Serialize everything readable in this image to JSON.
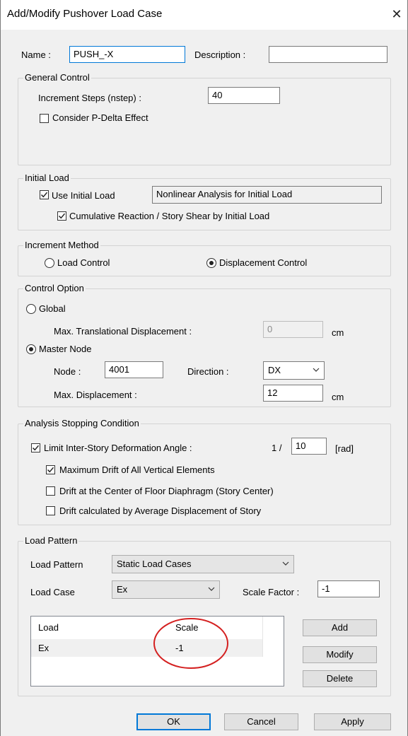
{
  "window": {
    "title": "Add/Modify Pushover Load Case"
  },
  "name_row": {
    "name_label": "Name :",
    "name_value": "PUSH_-X",
    "description_label": "Description :",
    "description_value": ""
  },
  "general_control": {
    "legend": "General Control",
    "increment_steps_label": "Increment Steps (nstep) :",
    "increment_steps_value": "40",
    "p_delta_label": "Consider P-Delta Effect",
    "p_delta_checked": false
  },
  "initial_load": {
    "legend": "Initial Load",
    "use_initial_load_label": "Use Initial Load",
    "use_initial_load_checked": true,
    "nonlinear_button_label": "Nonlinear Analysis for Initial Load",
    "cumulative_label": "Cumulative Reaction / Story Shear by Initial Load",
    "cumulative_checked": true
  },
  "increment_method": {
    "legend": "Increment Method",
    "load_control_label": "Load Control",
    "displacement_control_label": "Displacement Control",
    "selected": "displacement"
  },
  "control_option": {
    "legend": "Control Option",
    "global_label": "Global",
    "max_translational_label": "Max. Translational Displacement :",
    "max_translational_value": "0",
    "unit_cm": "cm",
    "master_node_label": "Master Node",
    "selected": "master",
    "node_label": "Node :",
    "node_value": "4001",
    "direction_label": "Direction :",
    "direction_value": "DX",
    "max_displacement_label": "Max. Displacement :",
    "max_displacement_value": "12",
    "unit_cm2": "cm"
  },
  "stopping": {
    "legend": "Analysis Stopping Condition",
    "limit_label": "Limit Inter-Story Deformation Angle  :",
    "limit_checked": true,
    "ratio_prefix": "1 /",
    "ratio_value": "10",
    "rad_unit": "[rad]",
    "options": [
      {
        "label": "Maximum Drift of All Vertical Elements",
        "checked": true
      },
      {
        "label": "Drift at the Center of Floor Diaphragm (Story Center)",
        "checked": false
      },
      {
        "label": "Drift calculated by Average Displacement of Story",
        "checked": false
      }
    ]
  },
  "load_pattern": {
    "legend": "Load Pattern",
    "pattern_label": "Load Pattern",
    "pattern_value": "Static Load Cases",
    "case_label": "Load Case",
    "case_value": "Ex",
    "scale_factor_label": "Scale Factor :",
    "scale_factor_value": "-1",
    "table": {
      "headers": [
        "Load",
        "Scale"
      ],
      "rows": [
        [
          "Ex",
          "-1"
        ]
      ]
    },
    "add_label": "Add",
    "modify_label": "Modify",
    "delete_label": "Delete",
    "annotation_color": "#d42020"
  },
  "footer": {
    "ok_label": "OK",
    "cancel_label": "Cancel",
    "apply_label": "Apply"
  },
  "colors": {
    "accent": "#0078d7",
    "window_bg": "#f0f0f0",
    "selected_row": "#f0f0f0"
  }
}
